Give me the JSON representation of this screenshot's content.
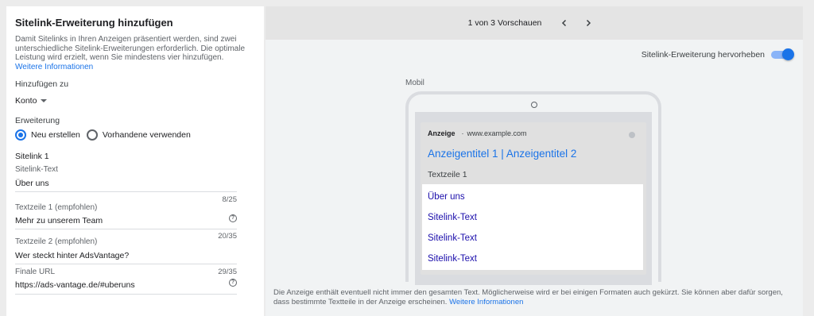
{
  "left": {
    "title": "Sitelink-Erweiterung hinzufügen",
    "description": "Damit Sitelinks in Ihren Anzeigen präsentiert werden, sind zwei unterschiedliche Sitelink-Erweiterungen erforderlich. Die optimale Leistung wird erzielt, wenn Sie mindestens vier hinzufügen.",
    "more_info_link": "Weitere Informationen",
    "add_to_label": "Hinzufügen zu",
    "add_to_value": "Konto",
    "extension_label": "Erweiterung",
    "radio_new": "Neu erstellen",
    "radio_existing": "Vorhandene verwenden",
    "sitelink_heading": "Sitelink 1",
    "fields": {
      "sitelink_text_label": "Sitelink-Text",
      "sitelink_text_value": "Über uns",
      "sitelink_text_counter": "8/25",
      "line1_label": "Textzeile 1 (empfohlen)",
      "line1_value": "Mehr zu unserem Team",
      "line1_counter": "20/35",
      "line2_label": "Textzeile 2 (empfohlen)",
      "line2_value": "Wer steckt hinter AdsVantage?",
      "line2_counter": "29/35",
      "url_label": "Finale URL",
      "url_value": "https://ads-vantage.de/#uberuns"
    }
  },
  "right": {
    "preview_nav": "1 von 3 Vorschauen",
    "toggle_label": "Sitelink-Erweiterung hervorheben",
    "toggle_on": true,
    "device_label": "Mobil",
    "ad": {
      "badge": "Anzeige",
      "display_url": "www.example.com",
      "headline": "Anzeigentitel 1 | Anzeigentitel 2",
      "description": "Textzeile 1",
      "sitelinks": [
        "Über uns",
        "Sitelink-Text",
        "Sitelink-Text",
        "Sitelink-Text"
      ]
    },
    "footer_note": "Die Anzeige enthält eventuell nicht immer den gesamten Text. Möglicherweise wird er bei einigen Formaten auch gekürzt. Sie können aber dafür sorgen, dass bestimmte Textteile in der Anzeige erscheinen.",
    "footer_link": "Weitere Informationen"
  },
  "colors": {
    "accent": "#1a73e8",
    "link_dark": "#1a0dab",
    "panel_bg": "#f1f3f4"
  }
}
